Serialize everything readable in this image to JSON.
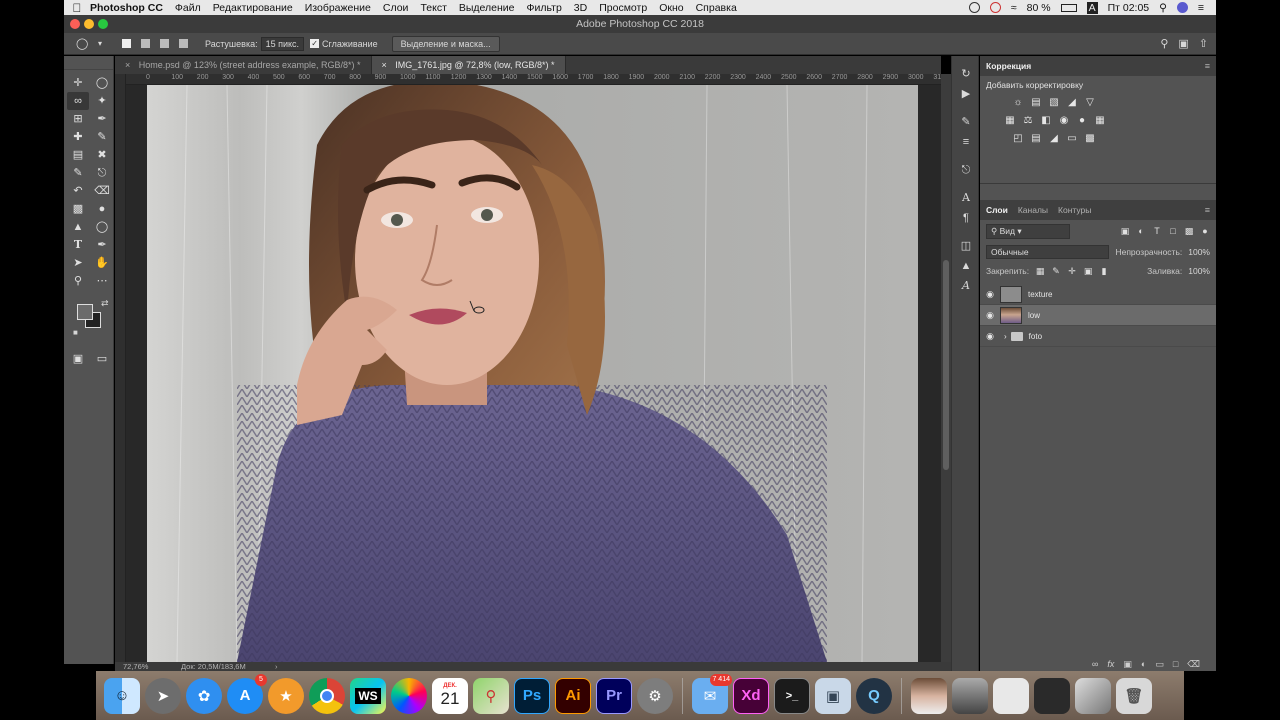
{
  "menubar": {
    "app_name": "Photoshop CC",
    "items": [
      "Файл",
      "Редактирование",
      "Изображение",
      "Слои",
      "Текст",
      "Выделение",
      "Фильтр",
      "3D",
      "Просмотр",
      "Окно",
      "Справка"
    ],
    "battery": "80 %",
    "keyboard": "A",
    "clock": "Пт 02:05"
  },
  "window": {
    "title": "Adobe Photoshop CC 2018"
  },
  "options_bar": {
    "feather_label": "Растушевка:",
    "feather_value": "15 пикс.",
    "antialias_label": "Сглаживание",
    "select_mask_button": "Выделение и маска..."
  },
  "tabs": [
    {
      "label": "Home.psd @ 123% (street address example, RGB/8*) *",
      "close": "×"
    },
    {
      "label": "IMG_1761.jpg @ 72,8% (low, RGB/8*) *",
      "close": "×"
    }
  ],
  "ruler": {
    "labels": [
      "0",
      "50",
      "100",
      "150",
      "200",
      "250",
      "300",
      "350",
      "400",
      "450",
      "500",
      "550",
      "600",
      "650",
      "700",
      "750",
      "800",
      "850",
      "900",
      "950",
      "1000",
      "1050",
      "1100",
      "1150",
      "1200",
      "1250",
      "1300",
      "1350",
      "1400",
      "1450",
      "1500",
      "1550",
      "1600",
      "1650",
      "1700",
      "1750",
      "1800",
      "1850",
      "1900",
      "1950",
      "2000",
      "2050",
      "2100",
      "2150",
      "2200",
      "2250",
      "2300",
      "2350",
      "2400",
      "2450",
      "2500",
      "2550",
      "2600",
      "2650",
      "2700",
      "2750",
      "2800",
      "2850",
      "2900",
      "2950",
      "3000",
      "3050",
      "3100"
    ]
  },
  "statusbar": {
    "zoom": "72,76%",
    "doc": "Док: 20,5M/183,6M",
    "arrow": "›"
  },
  "adjustments": {
    "tab": "Коррекция",
    "add_label": "Добавить корректировку"
  },
  "layers": {
    "tabs": [
      "Слои",
      "Каналы",
      "Контуры"
    ],
    "filter_select": "Вид",
    "blend_mode": "Обычные",
    "opacity_label": "Непрозрачность:",
    "opacity_value": "100%",
    "lock_label": "Закрепить:",
    "fill_label": "Заливка:",
    "fill_value": "100%",
    "items": [
      {
        "name": "texture",
        "type": "layer",
        "visible": true,
        "selected": false
      },
      {
        "name": "low",
        "type": "layer",
        "visible": true,
        "selected": true
      },
      {
        "name": "foto",
        "type": "group",
        "visible": true,
        "selected": false
      }
    ]
  },
  "dock": {
    "calendar_month": "ДЕК.",
    "calendar_day": "21",
    "appstore_badge": "5",
    "mail_badge": "7 414",
    "webstorm": "WS",
    "photoshop": "Ps",
    "illustrator": "Ai",
    "premiere": "Pr",
    "xd": "Xd",
    "terminal": ">_"
  },
  "colors": {
    "panel_bg": "#535353",
    "canvas_bg": "#282828",
    "photoshop_blue": "#31a8ff",
    "illustrator_orange": "#ff9a00",
    "premiere_purple": "#9999ff",
    "xd_pink": "#ff61f6"
  }
}
